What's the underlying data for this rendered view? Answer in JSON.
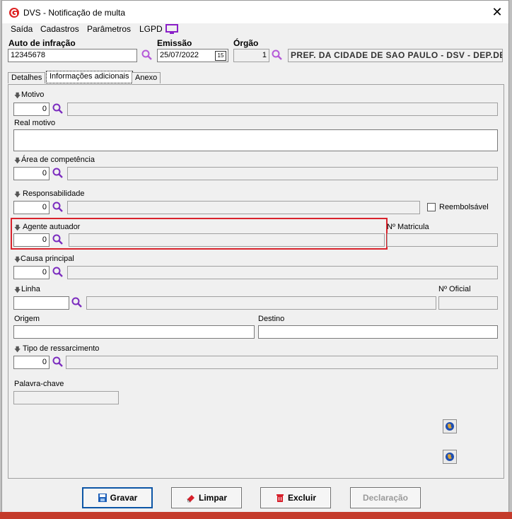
{
  "window": {
    "title": "DVS - Notificação de multa",
    "close_label": "✕"
  },
  "menu": {
    "items": [
      "Saída",
      "Cadastros",
      "Parâmetros",
      "LGPD"
    ]
  },
  "header": {
    "auto_label": "Auto de infração",
    "auto_value": "12345678",
    "emissao_label": "Emissão",
    "emissao_value": "25/07/2022",
    "calendar_label": "15",
    "orgao_label": "Órgão",
    "orgao_code": "1",
    "orgao_name": "PREF. DA CIDADE DE SAO PAULO - DSV - DEP.DE"
  },
  "tabs": [
    "Detalhes",
    "Informações adicionais",
    "Anexo"
  ],
  "form": {
    "motivo_label": "Motivo",
    "motivo_code": "0",
    "real_motivo_label": "Real motivo",
    "area_label": "Área de competência",
    "area_code": "0",
    "resp_label": "Responsabilidade",
    "resp_code": "0",
    "reembolsavel_label": "Reembolsável",
    "agente_label": "Agente autuador",
    "agente_code": "0",
    "matricula_label": "Nº Matricula",
    "causa_label": "Causa principal",
    "causa_code": "0",
    "linha_label": "Linha",
    "linha_value": "",
    "oficial_label": "Nº Oficial",
    "origem_label": "Origem",
    "destino_label": "Destino",
    "tipo_label": "Tipo de ressarcimento",
    "tipo_code": "0",
    "palavra_label": "Palavra-chave"
  },
  "buttons": {
    "gravar": "Gravar",
    "limpar": "Limpar",
    "excluir": "Excluir",
    "declaracao": "Declaração"
  },
  "colors": {
    "accent": "#7b2cbf",
    "highlight": "#d9232c",
    "primary_border": "#0d56a6"
  }
}
